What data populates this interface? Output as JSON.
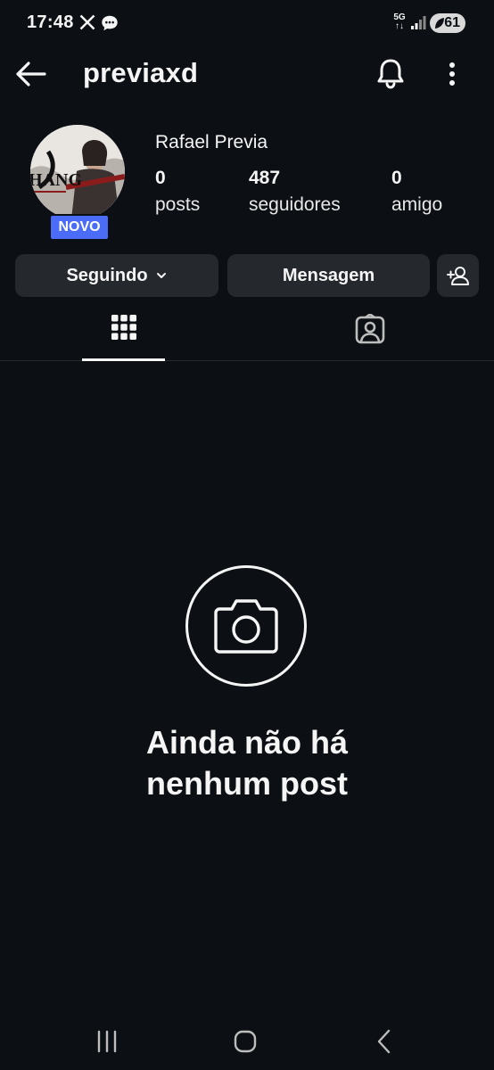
{
  "status_bar": {
    "time": "17:48",
    "network": "5G",
    "battery": "61",
    "icons": [
      "x-icon",
      "chat-icon",
      "signal-icon",
      "battery-icon"
    ]
  },
  "header": {
    "username": "previaxd",
    "icons": [
      "back-arrow-icon",
      "bell-icon",
      "more-vertical-icon"
    ]
  },
  "profile": {
    "display_name": "Rafael Previa",
    "badge": "NOVO",
    "avatar_text": "HANG",
    "stats": [
      {
        "value": "0",
        "label": "posts"
      },
      {
        "value": "487",
        "label": "seguidores"
      },
      {
        "value": "0",
        "label": "amigo"
      }
    ]
  },
  "actions": {
    "following_label": "Seguindo",
    "message_label": "Mensagem"
  },
  "tabs": {
    "items": [
      "grid-icon",
      "tagged-icon"
    ],
    "active_index": 0
  },
  "empty_state": {
    "title_line1": "Ainda não há",
    "title_line2": "nenhum post"
  },
  "colors": {
    "background": "#0c1014",
    "button": "#25292e",
    "badge": "#4a6cf7",
    "text": "#f5f5f5"
  }
}
